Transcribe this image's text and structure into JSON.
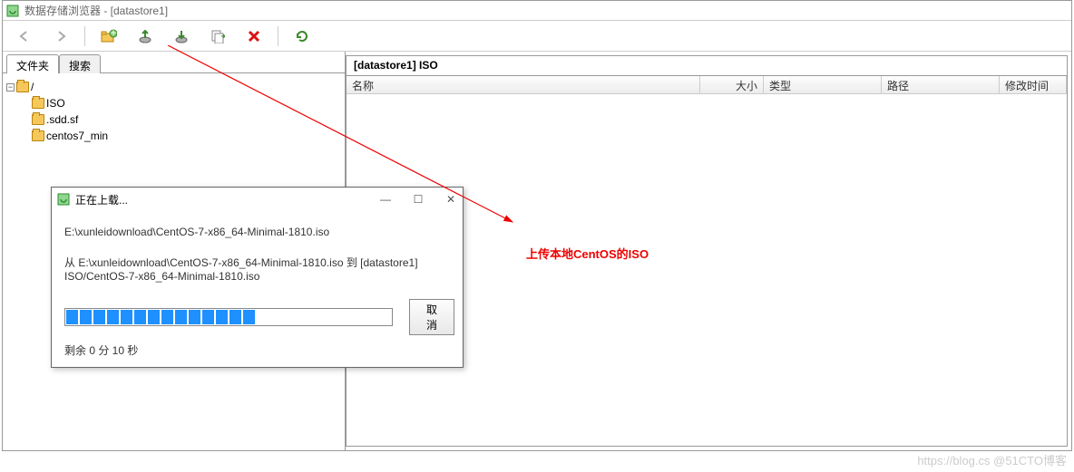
{
  "window": {
    "title": "数据存储浏览器 - [datastore1]"
  },
  "toolbar": {
    "icons": [
      "back-icon",
      "forward-icon",
      "new-folder-icon",
      "upload-icon",
      "download-icon",
      "copy-icon",
      "delete-icon",
      "refresh-icon"
    ]
  },
  "tabs": {
    "folders": "文件夹",
    "search": "搜索"
  },
  "tree": {
    "root": "/",
    "items": [
      "ISO",
      ".sdd.sf",
      "centos7_min"
    ]
  },
  "path_bar": "[datastore1] ISO",
  "columns": {
    "name": "名称",
    "size": "大小",
    "type": "类型",
    "path": "路径",
    "mtime": "修改时间"
  },
  "dialog": {
    "title": "正在上载...",
    "src": "E:\\xunleidownload\\CentOS-7-x86_64-Minimal-1810.iso",
    "desc": "从 E:\\xunleidownload\\CentOS-7-x86_64-Minimal-1810.iso 到 [datastore1] ISO/CentOS-7-x86_64-Minimal-1810.iso",
    "cancel": "取消",
    "remaining": "剩余 0 分 10 秒",
    "progress_filled": 14,
    "progress_total": 24
  },
  "annotation": "上传本地CentOS的ISO",
  "watermark": "https://blog.cs  @51CTO博客"
}
